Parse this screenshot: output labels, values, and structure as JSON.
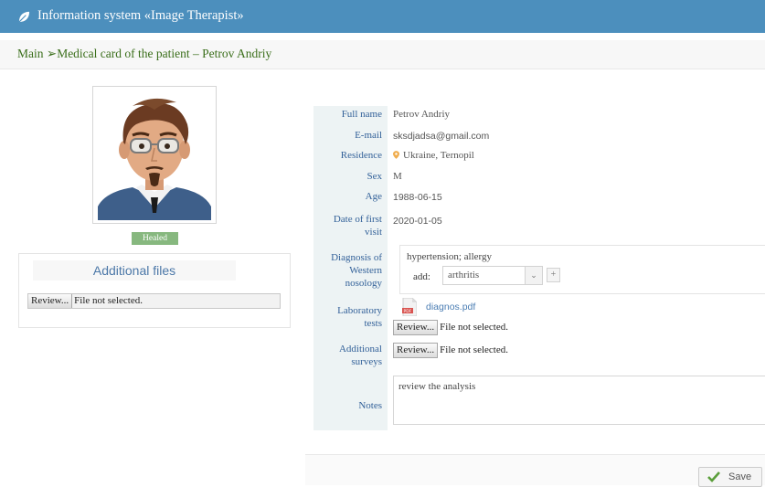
{
  "app": {
    "title": "Information system «Image Therapist»",
    "header_color": "#4c8fbd"
  },
  "breadcrumb": {
    "home": "Main",
    "separator": "➢",
    "current": "Medical card of the patient – Petrov Andriy"
  },
  "patient": {
    "status": "Healed",
    "status_color": "#87b87f"
  },
  "additional_files": {
    "heading": "Additional files",
    "browse_label": "Review...",
    "file_status": "File not selected."
  },
  "fields": {
    "full_name": {
      "label": "Full name",
      "value": "Petrov Andriy"
    },
    "email": {
      "label": "E-mail",
      "value": "sksdjadsa@gmail.com"
    },
    "residence": {
      "label": "Residence",
      "value": "Ukraine, Ternopil",
      "icon": "map-marker-icon"
    },
    "sex": {
      "label": "Sex",
      "value": "M"
    },
    "age": {
      "label": "Age",
      "value": "1988-06-15"
    },
    "first_visit": {
      "label_line1": "Date of first",
      "label_line2": "visit",
      "value": "2020-01-05"
    },
    "diagnosis": {
      "label_line1": "Diagnosis of",
      "label_line2": "Western",
      "label_line3": "nosology",
      "value": "hypertension; allergy",
      "add_label": "add:",
      "selected_option": "arthritis",
      "plus_label": "+"
    },
    "lab_tests": {
      "label_line1": "Laboratory",
      "label_line2": "tests",
      "file_name": "diagnos.pdf",
      "browse_label": "Review...",
      "file_status": "File not selected."
    },
    "surveys": {
      "label_line1": "Additional",
      "label_line2": "surveys",
      "browse_label": "Review...",
      "file_status": "File not selected."
    },
    "notes": {
      "label": "Notes",
      "value": "review the analysis"
    }
  },
  "footer": {
    "save_label": "Save",
    "save_icon": "check-icon"
  }
}
